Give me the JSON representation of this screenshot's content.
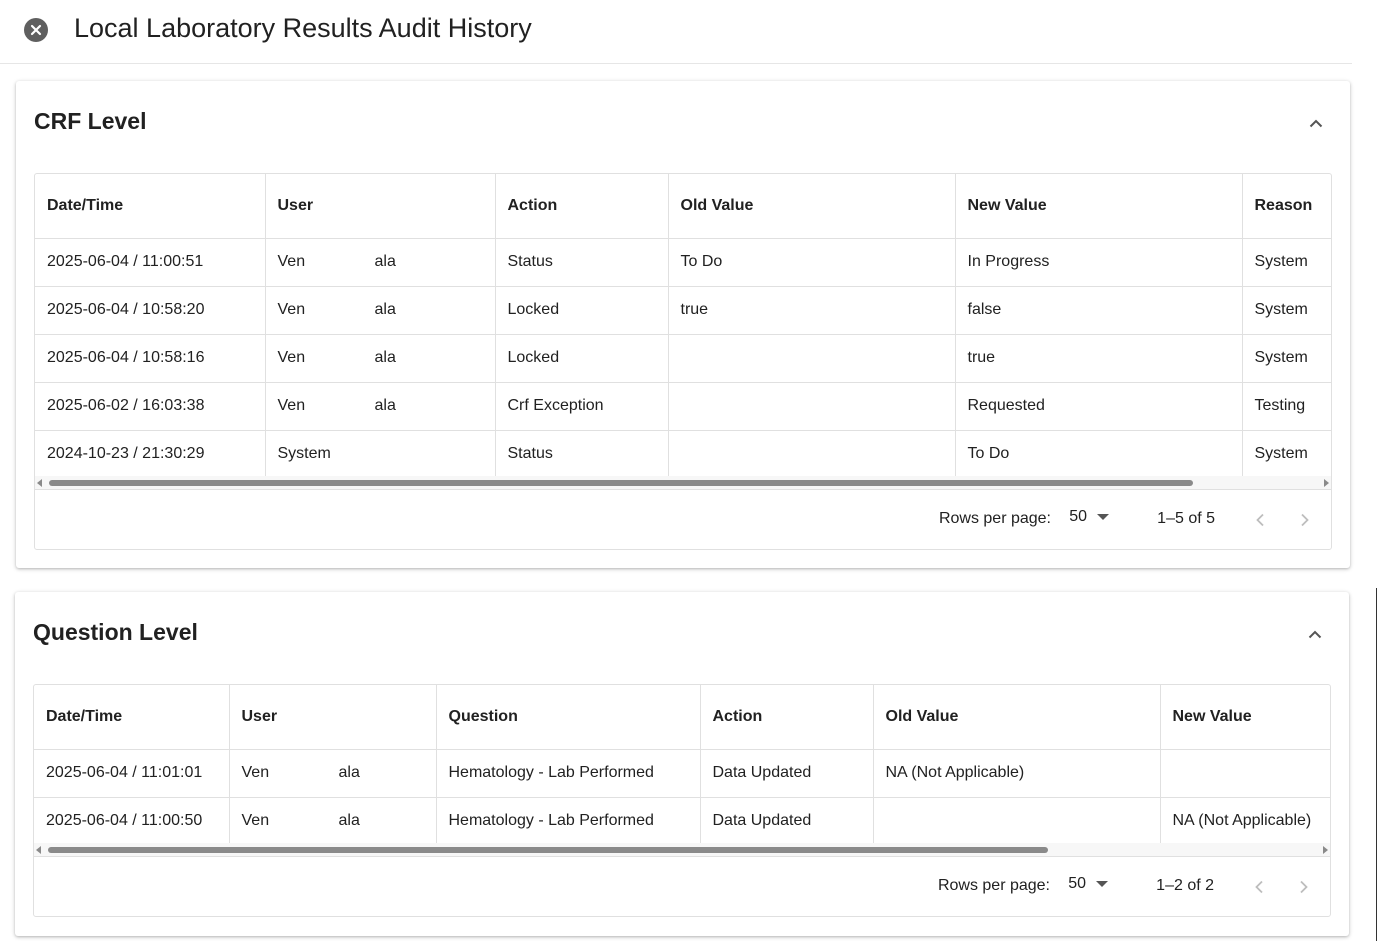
{
  "page": {
    "title": "Local Laboratory Results Audit History",
    "close_icon": "close-circle-icon"
  },
  "crf": {
    "title": "CRF Level",
    "collapse_icon": "chevron-up-icon",
    "columns": [
      "Date/Time",
      "User",
      "Action",
      "Old Value",
      "New Value",
      "Reason"
    ],
    "rows": [
      [
        "2025-06-04 / 11:00:51",
        "Ven",
        "ala",
        "Status",
        "To Do",
        "In Progress",
        "System"
      ],
      [
        "2025-06-04 / 10:58:20",
        "Ven",
        "ala",
        "Locked",
        "true",
        "false",
        "System"
      ],
      [
        "2025-06-04 / 10:58:16",
        "Ven",
        "ala",
        "Locked",
        "",
        "true",
        "System"
      ],
      [
        "2025-06-02 / 16:03:38",
        "Ven",
        "ala",
        "Crf Exception",
        "",
        "Requested",
        "Testing"
      ],
      [
        "2024-10-23 / 21:30:29",
        "System",
        "",
        "Status",
        "",
        "To Do",
        "System"
      ]
    ],
    "pagination": {
      "rows_per_page_label": "Rows per page:",
      "rows_per_page": "50",
      "range": "1–5 of 5"
    }
  },
  "question": {
    "title": "Question Level",
    "collapse_icon": "chevron-up-icon",
    "columns": [
      "Date/Time",
      "User",
      "Question",
      "Action",
      "Old Value",
      "New Value"
    ],
    "rows": [
      [
        "2025-06-04 / 11:01:01",
        "Ven",
        "ala",
        "Hematology - Lab Performed",
        "Data Updated",
        "NA (Not Applicable)",
        ""
      ],
      [
        "2025-06-04 / 11:00:50",
        "Ven",
        "ala",
        "Hematology - Lab Performed",
        "Data Updated",
        "",
        "NA (Not Applicable)"
      ]
    ],
    "pagination": {
      "rows_per_page_label": "Rows per page:",
      "rows_per_page": "50",
      "range": "1–2 of 2"
    }
  }
}
